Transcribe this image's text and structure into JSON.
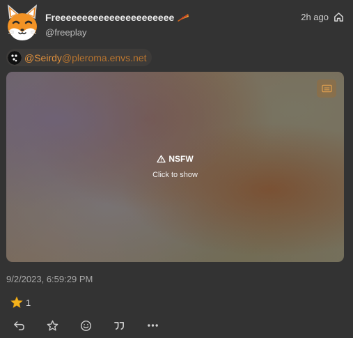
{
  "author": {
    "display_name": "Freeeeeeeeeeeeeeeeeeeeee",
    "handle": "@freeplay",
    "name_emoji": "pizza-emoji",
    "avatar": "fox-avatar"
  },
  "meta": {
    "relative_time": "2h ago",
    "visibility_icon": "home-icon"
  },
  "mention": {
    "user": "@Seirdy",
    "domain": "@pleroma.envs.net",
    "avatar": "mention-avatar"
  },
  "media": {
    "warning_title": "NSFW",
    "warning_subtitle": "Click to show",
    "alt_icon": "alt-text-icon"
  },
  "footer": {
    "full_date": "9/2/2023, 6:59:29 PM",
    "reaction_emoji": "star-emoji",
    "reaction_count": "1"
  },
  "actions": [
    {
      "name": "reply",
      "icon": "reply-icon"
    },
    {
      "name": "favourite",
      "icon": "star-icon"
    },
    {
      "name": "react",
      "icon": "smiley-icon"
    },
    {
      "name": "quote",
      "icon": "quote-icon"
    },
    {
      "name": "more",
      "icon": "more-icon"
    }
  ],
  "colors": {
    "background": "#333333",
    "accent": "#e1913d",
    "mention_domain": "#b9752f",
    "muted_text": "#a9a9a9"
  }
}
